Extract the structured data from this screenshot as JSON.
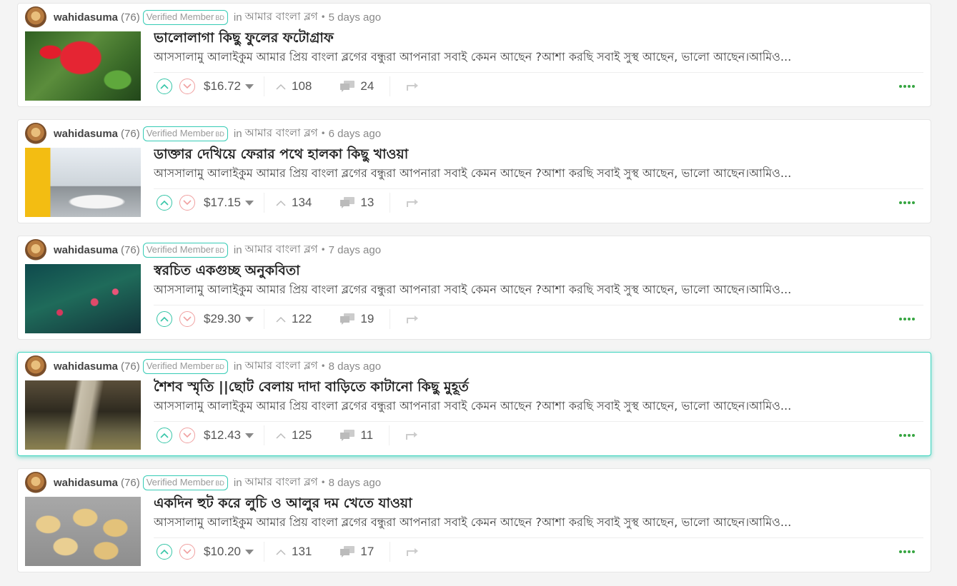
{
  "posts": [
    {
      "author": "wahidasuma",
      "reputation": "(76)",
      "badge": "Verified Member",
      "badge_suffix": "BD",
      "in_label": "in",
      "community": "আমার বাংলা ব্লগ",
      "time_ago": "5 days ago",
      "title": "ভালোলাগা কিছু ফুলের ফটোগ্রাফ",
      "summary": "আসসালামু আলাইকুম আমার প্রিয় বাংলা ব্লগের বন্ধুরা আপনারা সবাই কেমন আছেন ?আশা করছি সবাই সুস্থ আছেন, ভালো আছেন।আমিও...",
      "payout": "$16.72",
      "votes": "108",
      "comments": "24"
    },
    {
      "author": "wahidasuma",
      "reputation": "(76)",
      "badge": "Verified Member",
      "badge_suffix": "BD",
      "in_label": "in",
      "community": "আমার বাংলা ব্লগ",
      "time_ago": "6 days ago",
      "title": "ডাক্তার দেখিয়ে ফেরার পথে হালকা কিছু খাওয়া",
      "summary": "আসসালামু আলাইকুম আমার প্রিয় বাংলা ব্লগের বন্ধুরা আপনারা সবাই কেমন আছেন ?আশা করছি সবাই সুস্থ আছেন, ভালো আছেন।আমিও...",
      "payout": "$17.15",
      "votes": "134",
      "comments": "13"
    },
    {
      "author": "wahidasuma",
      "reputation": "(76)",
      "badge": "Verified Member",
      "badge_suffix": "BD",
      "in_label": "in",
      "community": "আমার বাংলা ব্লগ",
      "time_ago": "7 days ago",
      "title": "স্বরচিত একগুচ্ছ অনুকবিতা",
      "summary": "আসসালামু আলাইকুম আমার প্রিয় বাংলা ব্লগের বন্ধুরা আপনারা সবাই কেমন আছেন ?আশা করছি সবাই সুস্থ আছেন, ভালো আছেন।আমিও...",
      "payout": "$29.30",
      "votes": "122",
      "comments": "19"
    },
    {
      "author": "wahidasuma",
      "reputation": "(76)",
      "badge": "Verified Member",
      "badge_suffix": "BD",
      "in_label": "in",
      "community": "আমার বাংলা ব্লগ",
      "time_ago": "8 days ago",
      "title": "শৈশব স্মৃতি ||ছোট বেলায় দাদা বাড়িতে কাটানো কিছু মুহূর্ত",
      "summary": "আসসালামু আলাইকুম আমার প্রিয় বাংলা ব্লগের বন্ধুরা আপনারা সবাই কেমন আছেন ?আশা করছি সবাই সুস্থ আছেন, ভালো আছেন।আমিও...",
      "payout": "$12.43",
      "votes": "125",
      "comments": "11"
    },
    {
      "author": "wahidasuma",
      "reputation": "(76)",
      "badge": "Verified Member",
      "badge_suffix": "BD",
      "in_label": "in",
      "community": "আমার বাংলা ব্লগ",
      "time_ago": "8 days ago",
      "title": "একদিন হুট করে লুচি ও আলুর দম খেতে যাওয়া",
      "summary": "আসসালামু আলাইকুম আমার প্রিয় বাংলা ব্লগের বন্ধুরা আপনারা সবাই কেমন আছেন ?আশা করছি সবাই সুস্থ আছেন, ভালো আছেন।আমিও...",
      "payout": "$10.20",
      "votes": "131",
      "comments": "17"
    }
  ],
  "colors": {
    "upvote": "#35c5a7",
    "downvote": "#f0a0a0",
    "more_dots": "#36a541",
    "highlight_border": "#3fd5bf"
  },
  "icons": {
    "upvote": "chevron-up-circle-icon",
    "downvote": "chevron-down-circle-icon",
    "payout_dropdown": "caret-down-icon",
    "votes": "chevron-up-icon",
    "comments": "comments-icon",
    "reblog": "reblog-icon",
    "more": "more-dots-icon"
  }
}
